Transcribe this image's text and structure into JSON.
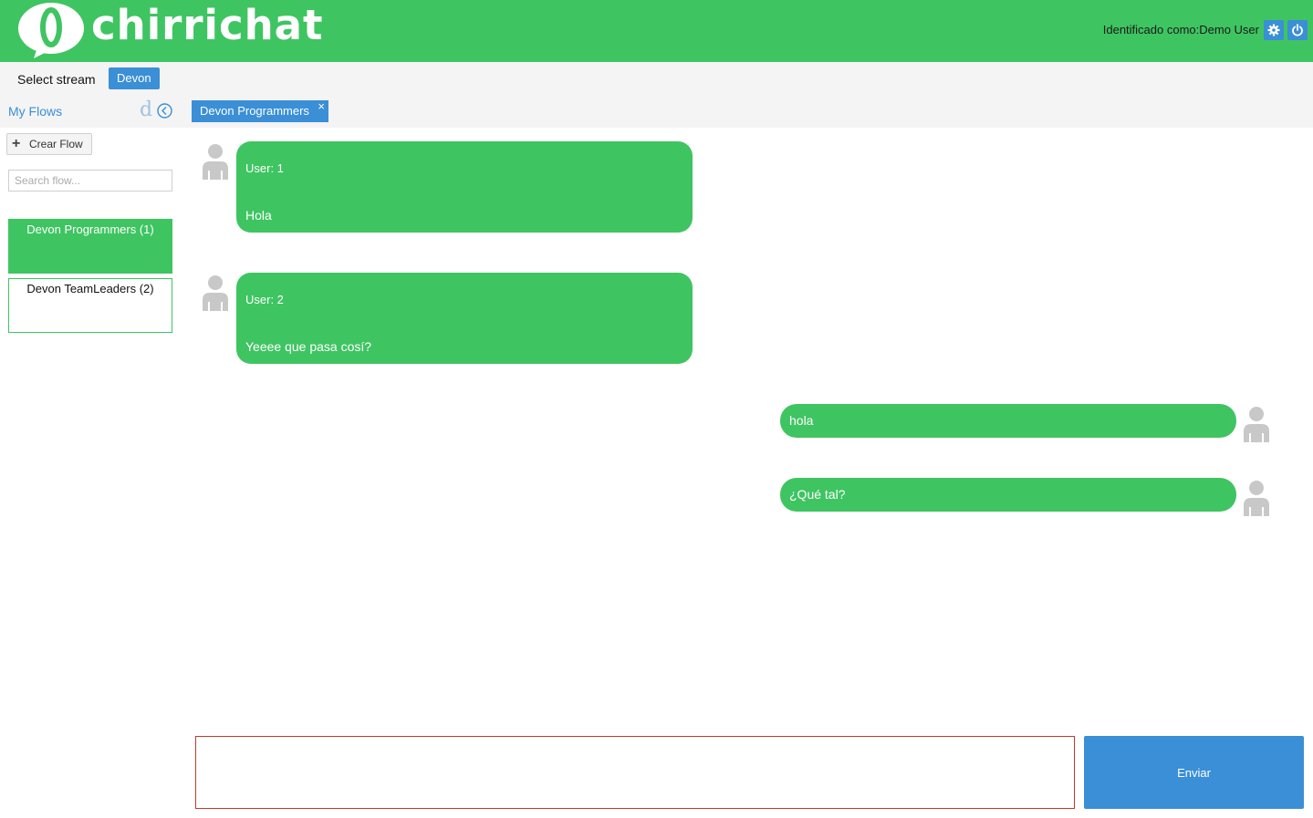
{
  "header": {
    "brand": "chirrichat",
    "user_label": "Identificado como:Demo User",
    "settings_icon": "gear-icon",
    "power_icon": "power-icon"
  },
  "stream": {
    "label": "Select stream",
    "selected": "Devon"
  },
  "sidebar": {
    "title": "My Flows",
    "d_glyph": "d",
    "create_button": "Crear Flow",
    "search_placeholder": "Search flow...",
    "flows": [
      {
        "label": "Devon Programmers (1)",
        "active": true
      },
      {
        "label": "Devon TeamLeaders (2)",
        "active": false
      }
    ]
  },
  "tabs": [
    {
      "label": "Devon Programmers",
      "close": "×"
    }
  ],
  "messages": [
    {
      "side": "left",
      "user": "User: 1",
      "text": "Hola"
    },
    {
      "side": "left",
      "user": "User: 2",
      "text": "Yeeee que pasa cosí?"
    },
    {
      "side": "right",
      "text": "hola"
    },
    {
      "side": "right",
      "text": "¿Qué tal?"
    }
  ],
  "composer": {
    "value": "",
    "send_label": "Enviar"
  },
  "colors": {
    "brand_green": "#3fc462",
    "accent_blue": "#3a8fd6",
    "composer_border": "#c0392b"
  }
}
